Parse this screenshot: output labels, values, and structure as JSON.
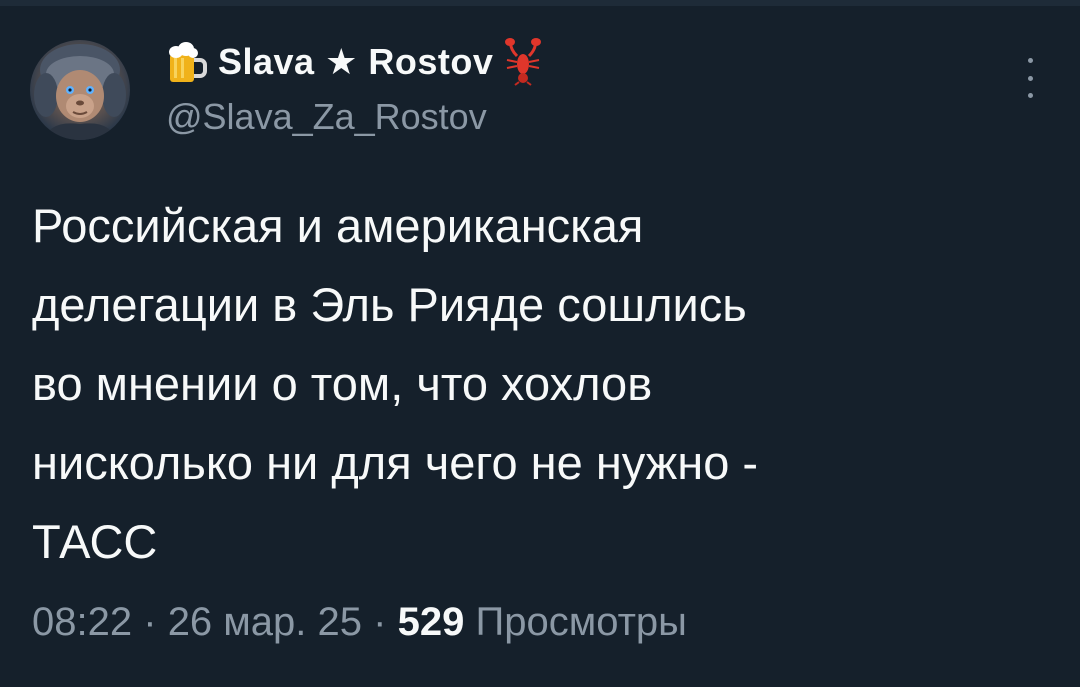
{
  "author": {
    "display_name": "Slava ★ Rostov",
    "handle": "@Slava_Za_Rostov",
    "name_emoji_left": "beer-mug-icon",
    "name_emoji_right": "lobster-icon"
  },
  "tweet": {
    "text": "Российская и американская\nделегации в Эль Рияде сошлись\nво мнении о том, что хохлов\nнисколько ни для чего не нужно -\nТАСС"
  },
  "meta": {
    "time": "08:22",
    "separator": "·",
    "date": "26 мар. 25",
    "views_count": "529",
    "views_label": "Просмотры"
  },
  "colors": {
    "background": "#15202b",
    "text_primary": "#f7f9f9",
    "text_secondary": "#8b98a5"
  }
}
